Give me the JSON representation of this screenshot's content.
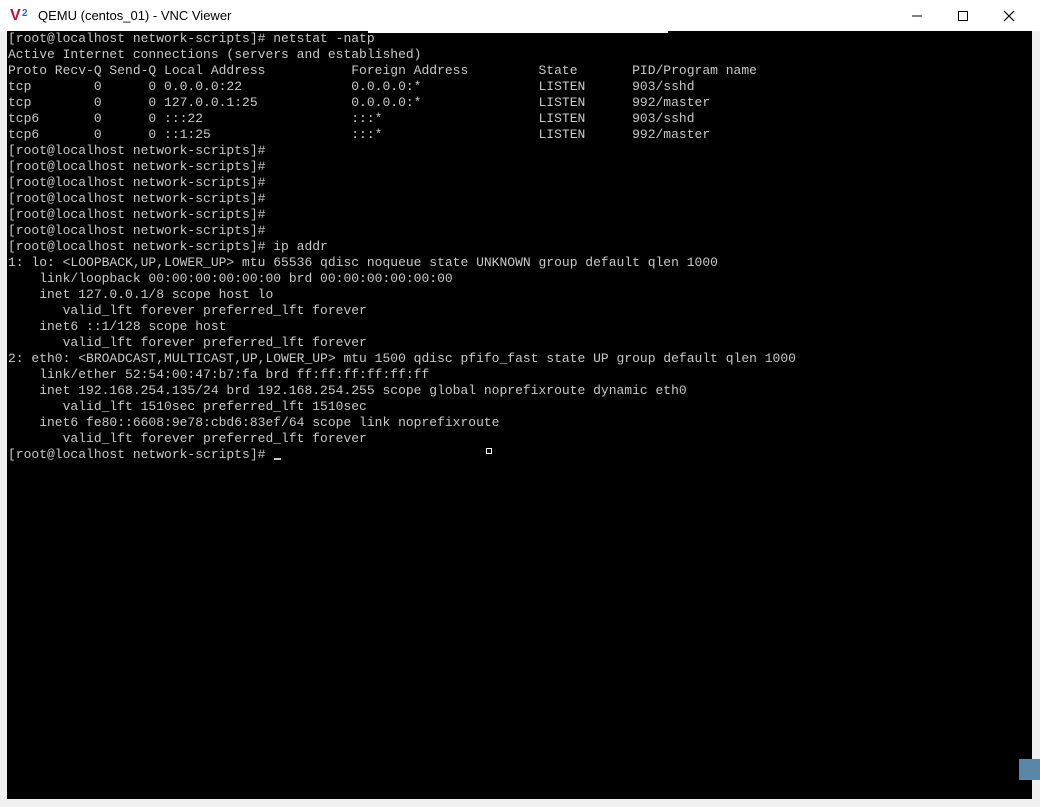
{
  "window": {
    "title": "QEMU (centos_01) - VNC Viewer",
    "icon": "vnc-viewer-icon",
    "controls": [
      "minimize",
      "maximize",
      "close"
    ]
  },
  "terminal": {
    "lines": [
      "[root@localhost network-scripts]# netstat -natp",
      "Active Internet connections (servers and established)",
      "Proto Recv-Q Send-Q Local Address           Foreign Address         State       PID/Program name",
      "tcp        0      0 0.0.0.0:22              0.0.0.0:*               LISTEN      903/sshd",
      "tcp        0      0 127.0.0.1:25            0.0.0.0:*               LISTEN      992/master",
      "tcp6       0      0 :::22                   :::*                    LISTEN      903/sshd",
      "tcp6       0      0 ::1:25                  :::*                    LISTEN      992/master",
      "[root@localhost network-scripts]#",
      "[root@localhost network-scripts]#",
      "[root@localhost network-scripts]#",
      "[root@localhost network-scripts]#",
      "[root@localhost network-scripts]#",
      "[root@localhost network-scripts]#",
      "[root@localhost network-scripts]# ip addr",
      "1: lo: <LOOPBACK,UP,LOWER_UP> mtu 65536 qdisc noqueue state UNKNOWN group default qlen 1000",
      "    link/loopback 00:00:00:00:00:00 brd 00:00:00:00:00:00",
      "    inet 127.0.0.1/8 scope host lo",
      "       valid_lft forever preferred_lft forever",
      "    inet6 ::1/128 scope host",
      "       valid_lft forever preferred_lft forever",
      "2: eth0: <BROADCAST,MULTICAST,UP,LOWER_UP> mtu 1500 qdisc pfifo_fast state UP group default qlen 1000",
      "    link/ether 52:54:00:47:b7:fa brd ff:ff:ff:ff:ff:ff",
      "    inet 192.168.254.135/24 brd 192.168.254.255 scope global noprefixroute dynamic eth0",
      "       valid_lft 1510sec preferred_lft 1510sec",
      "    inet6 fe80::6608:9e78:cbd6:83ef/64 scope link noprefixroute",
      "       valid_lft forever preferred_lft forever"
    ],
    "prompt": "[root@localhost network-scripts]# "
  },
  "colors": {
    "terminal_bg": "#000000",
    "terminal_fg": "#c8c8c8",
    "titlebar_bg": "#ffffff",
    "scroll_thumb": "#5a86a8"
  }
}
